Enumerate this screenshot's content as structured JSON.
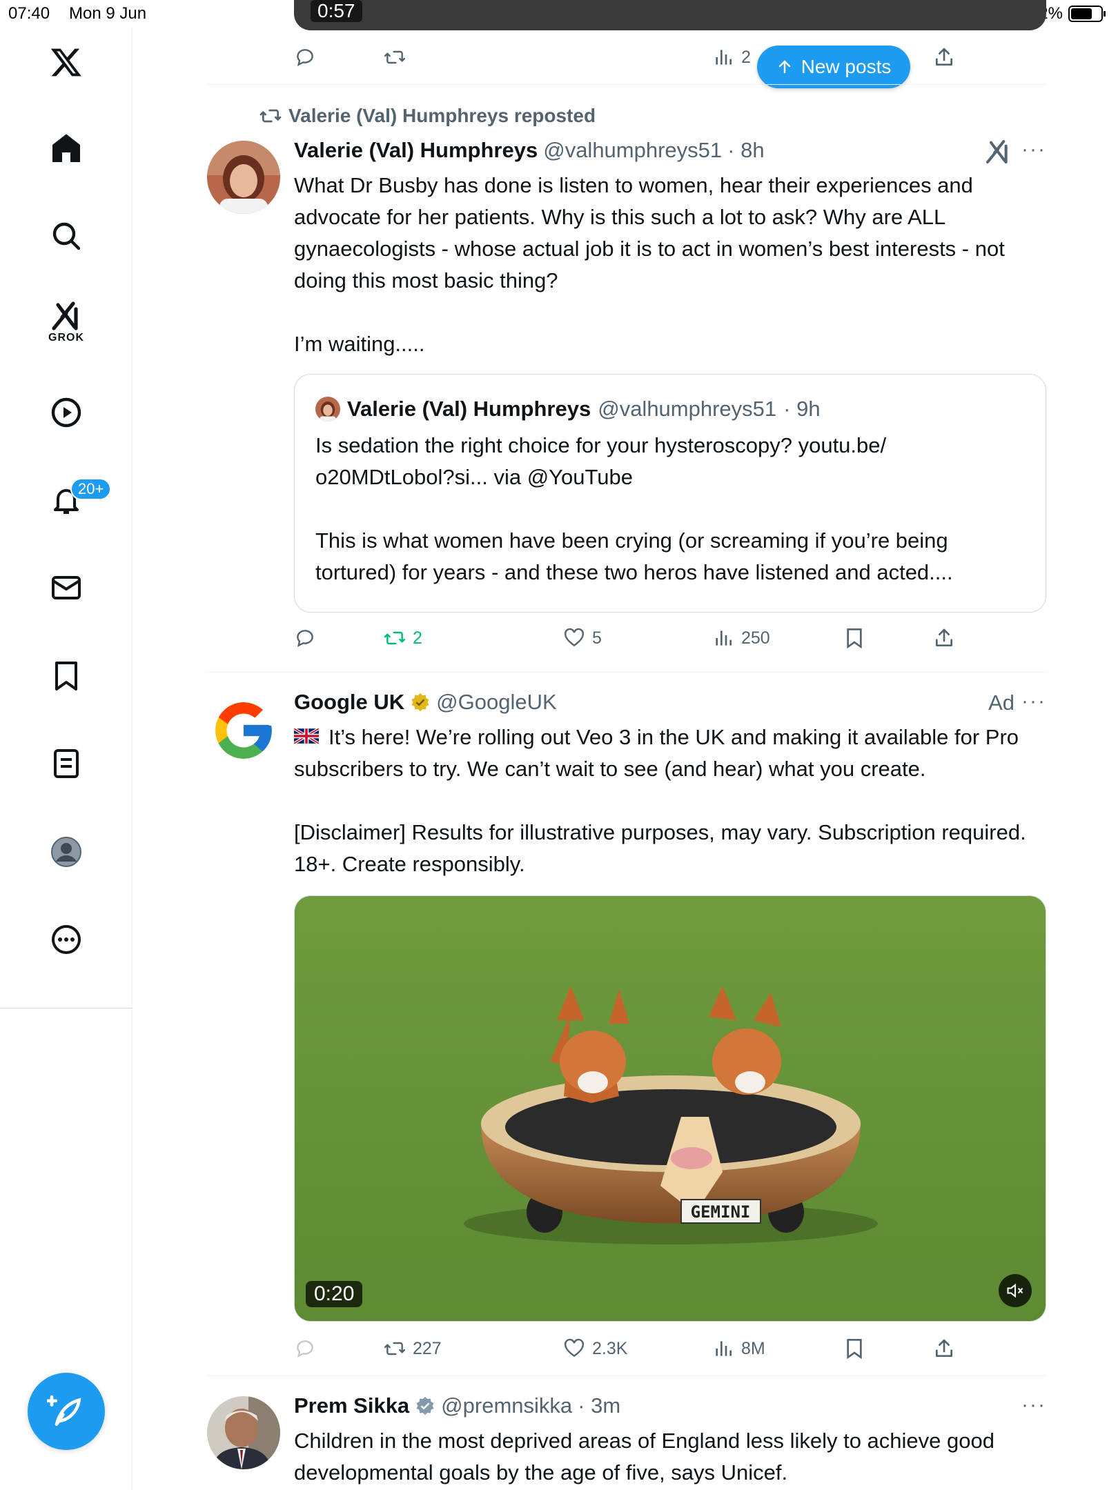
{
  "status_bar": {
    "time": "07:40",
    "date": "Mon 9 Jun",
    "battery": "72%"
  },
  "sidebar": {
    "logo": "X",
    "grok_label": "GROK",
    "notifications_badge": "20+"
  },
  "new_posts_label": "New posts",
  "top_stub": {
    "duration": "0:57",
    "views": "2"
  },
  "post1": {
    "repost_label": "Valerie (Val) Humphreys reposted",
    "name": "Valerie (Val) Humphreys",
    "handle": "@valhumphreys51",
    "time": "· 8h",
    "text": "What Dr Busby has done is listen to women, hear their experiences and advocate for her patients. Why is this such a lot to ask? Why are ALL gynaecologists - whose actual job it is to act in women’s best interests - not doing this most basic thing?\n\nI’m waiting.....",
    "quote": {
      "name": "Valerie (Val) Humphreys",
      "handle": "@valhumphreys51",
      "time": "· 9h",
      "text": "Is sedation the right choice for your hysteroscopy? youtu.be/\no20MDtLobol?si... via @YouTube\n\nThis is what women have been crying (or screaming if you’re being tortured) for years - and these two heros have listened and acted...."
    },
    "reposts": "2",
    "likes": "5",
    "views": "250"
  },
  "post2": {
    "name": "Google UK",
    "handle": "@GoogleUK",
    "ad_label": "Ad",
    "text": "It’s here! We’re rolling out Veo 3 in the UK and making it available for Pro subscribers to try. We can’t wait to see (and hear) what you create.\n\n[Disclaimer] Results for illustrative purposes, may vary. Subscription required. 18+. Create responsibly.",
    "video_duration": "0:20",
    "plate_text": "GEMINI",
    "reposts": "227",
    "likes": "2.3K",
    "views": "8M"
  },
  "post3": {
    "name": "Prem Sikka",
    "handle": "@premnsikka",
    "time": "· 3m",
    "text": "Children in the most deprived areas of England less likely to achieve good developmental goals by the age of five, says Unicef."
  },
  "colors": {
    "accent": "#1d9bf0",
    "text": "#0f1419",
    "muted": "#536471",
    "repost_green": "#00ba7c",
    "verified_gold": "#e2b719",
    "verified_grey": "#829aab"
  }
}
